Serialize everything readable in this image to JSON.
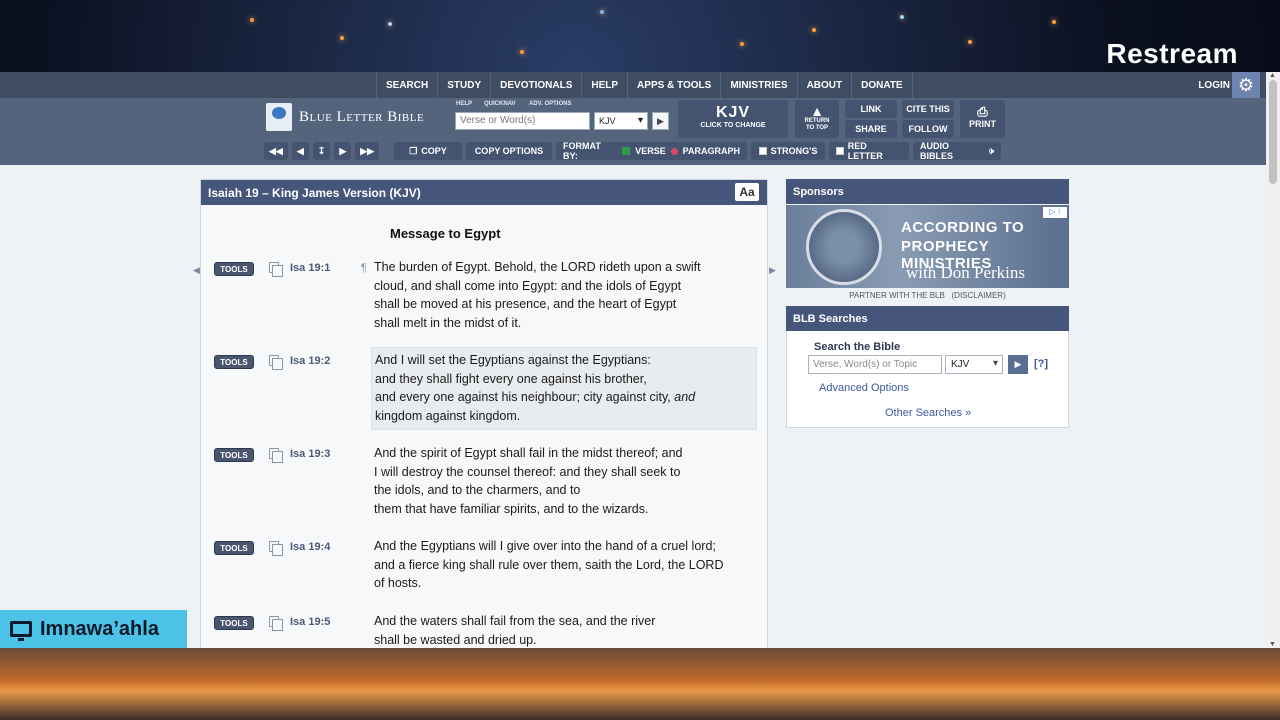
{
  "overlay": {
    "brand": "Restream",
    "streamer": "Imnawa’ahla"
  },
  "nav": {
    "menu": [
      "SEARCH",
      "STUDY",
      "DEVOTIONALS",
      "HELP",
      "APPS & TOOLS",
      "MINISTRIES",
      "ABOUT",
      "DONATE"
    ],
    "login": "LOGIN"
  },
  "toolbar": {
    "site_name": "Blue Letter Bible",
    "mini_links": [
      "HELP",
      "QUICKNAV",
      "ADV. OPTIONS"
    ],
    "verse_placeholder": "Verse or Word(s)",
    "version_select": "KJV",
    "version_big": "KJV",
    "version_hint": "CLICK TO CHANGE",
    "return_top": [
      "RETURN",
      "TO TOP"
    ],
    "link": "LINK",
    "cite": "CITE THIS",
    "share": "SHARE",
    "follow": "FOLLOW",
    "print": "PRINT",
    "copy": "COPY",
    "copy_options": "COPY OPTIONS",
    "format_by": "FORMAT BY:",
    "verse": "VERSE",
    "paragraph": "PARAGRAPH",
    "strongs": "STRONG'S",
    "red_letter": "RED LETTER",
    "audio": "AUDIO BIBLES"
  },
  "chapter": {
    "title": "Isaiah 19 – King James Version (KJV)",
    "font_button": "Aa",
    "section_heading": "Message to Egypt",
    "tools_label": "TOOLS",
    "verses": [
      {
        "ref": "Isa 19:1",
        "lines": [
          "The burden of Egypt. Behold, the LORD rideth upon a swift",
          "cloud, and shall come into Egypt: and the idols of Egypt",
          "shall be moved at his presence, and the heart of Egypt",
          "shall melt in the midst of it."
        ]
      },
      {
        "ref": "Isa 19:2",
        "lines": [
          "And I will set the Egyptians against the Egyptians:",
          "and they shall fight every one against his brother,",
          "and every one against his neighbour; city against city,",
          "kingdom against kingdom."
        ],
        "italic": "and"
      },
      {
        "ref": "Isa 19:3",
        "lines": [
          "And the spirit of Egypt shall fail in the midst thereof; and",
          "I will destroy the counsel thereof: and they shall seek to",
          "the idols, and to the charmers, and to",
          "them that have familiar spirits, and to the wizards."
        ]
      },
      {
        "ref": "Isa 19:4",
        "lines": [
          "And the Egyptians will I give over into the hand of a cruel lord;",
          "and a fierce king shall rule over them, saith the Lord, the LORD",
          "of hosts."
        ]
      },
      {
        "ref": "Isa 19:5",
        "lines": [
          "And the waters shall fail from the sea, and the river",
          "shall be wasted and dried up."
        ]
      }
    ]
  },
  "sponsors": {
    "title": "Sponsors",
    "ad_line1": "ACCORDING TO",
    "ad_line2": "PROPHECY MINISTRIES",
    "ad_line3": "with Don Perkins",
    "partner": "PARTNER WITH THE BLB",
    "disclaimer": "(DISCLAIMER)"
  },
  "searches": {
    "title": "BLB Searches",
    "label": "Search the Bible",
    "placeholder": "Verse, Word(s) or Topic",
    "version": "KJV",
    "help": "[?]",
    "advanced": "Advanced Options",
    "other": "Other Searches »"
  }
}
